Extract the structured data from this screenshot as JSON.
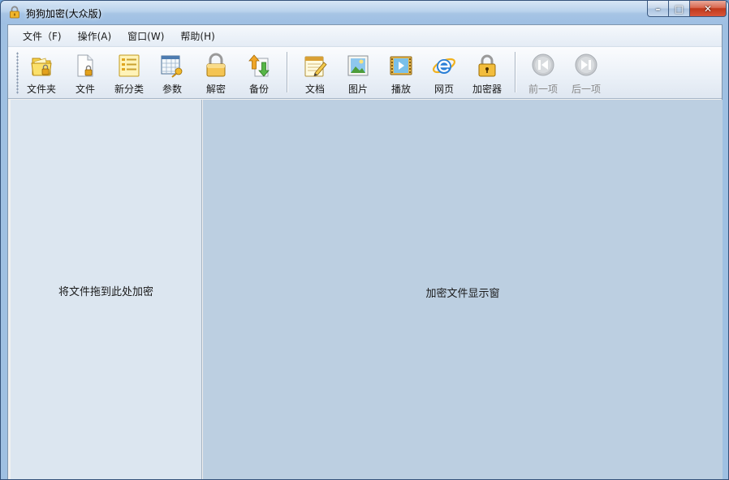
{
  "window": {
    "title": "狗狗加密(大众版)",
    "caption": {
      "minimize": "–",
      "maximize": "□",
      "close": "✕"
    }
  },
  "menu": [
    {
      "name": "menu-file",
      "label": "文件（F)"
    },
    {
      "name": "menu-operate",
      "label": "操作(A)"
    },
    {
      "name": "menu-window",
      "label": "窗口(W)"
    },
    {
      "name": "menu-help",
      "label": "帮助(H)"
    }
  ],
  "toolbar": {
    "group1": [
      {
        "name": "folder",
        "label": "文件夹",
        "icon": "folder-lock-icon"
      },
      {
        "name": "file",
        "label": "文件",
        "icon": "file-lock-icon"
      },
      {
        "name": "new-category",
        "label": "新分类",
        "icon": "list-icon"
      },
      {
        "name": "params",
        "label": "参数",
        "icon": "grid-key-icon"
      },
      {
        "name": "decrypt",
        "label": "解密",
        "icon": "unlock-icon"
      },
      {
        "name": "backup",
        "label": "备份",
        "icon": "backup-arrows-icon"
      }
    ],
    "group2": [
      {
        "name": "document",
        "label": "文档",
        "icon": "notepad-icon"
      },
      {
        "name": "image",
        "label": "图片",
        "icon": "picture-icon"
      },
      {
        "name": "play",
        "label": "播放",
        "icon": "film-icon"
      },
      {
        "name": "webpage",
        "label": "网页",
        "icon": "ie-icon"
      },
      {
        "name": "encryptor",
        "label": "加密器",
        "icon": "padlock-icon"
      }
    ],
    "group3": [
      {
        "name": "prev",
        "label": "前一项",
        "icon": "prev-icon",
        "disabled": true
      },
      {
        "name": "next",
        "label": "后一项",
        "icon": "next-icon",
        "disabled": true
      }
    ]
  },
  "left_pane": {
    "text": "将文件拖到此处加密"
  },
  "right_pane": {
    "text": "加密文件显示窗"
  }
}
